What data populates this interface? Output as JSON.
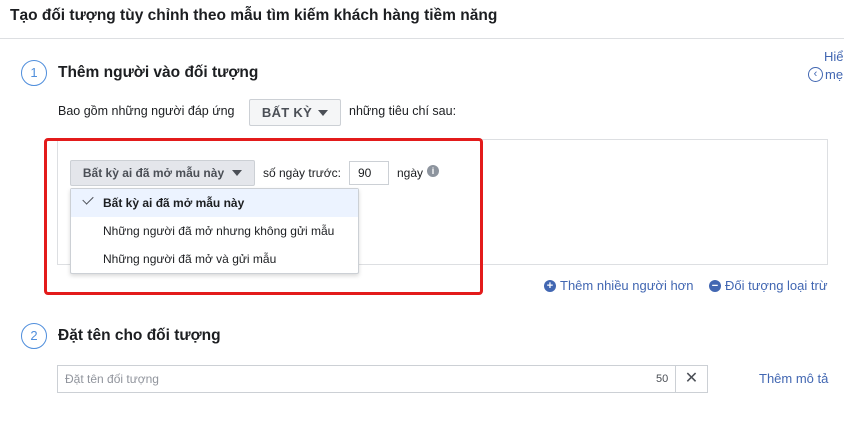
{
  "header": {
    "title": "Tạo đối tượng tùy chỉnh theo mẫu tìm kiếm khách hàng tiềm năng"
  },
  "help": {
    "line1": "Hiể",
    "line2": "mẹ",
    "icon": "question-circle-icon"
  },
  "step1": {
    "number": "1",
    "title": "Thêm người vào đối tượng",
    "include_prefix": "Bao gồm những người đáp ứng",
    "match_value": "BẤT KỲ",
    "include_suffix": "những tiêu chí sau:",
    "condition": {
      "selected": "Bất kỳ ai đã mở mẫu này",
      "days_label": "số ngày trước:",
      "days_value": "90",
      "days_unit": "ngày",
      "options": [
        "Bất kỳ ai đã mở mẫu này",
        "Những người đã mở nhưng không gửi mẫu",
        "Những người đã mở và gửi mẫu"
      ]
    },
    "add_more": "Thêm nhiều người hơn",
    "exclude": "Đối tượng loại trừ"
  },
  "step2": {
    "number": "2",
    "title": "Đặt tên cho đối tượng",
    "name_placeholder": "Đặt tên đối tượng",
    "char_count": "50",
    "clear_symbol": "✕",
    "add_description": "Thêm mô tả"
  },
  "colors": {
    "accent": "#4267b2",
    "step_circle": "#4f8edc",
    "highlight_box": "#e31b1b"
  }
}
